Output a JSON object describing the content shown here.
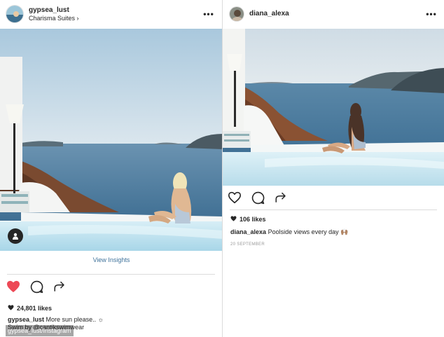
{
  "left_post": {
    "username": "gypsea_lust",
    "location": "Charisma Suites",
    "location_chevron": "›",
    "more_label": "•••",
    "insights_link": "View Insights",
    "liked": true,
    "likes_text": "24,801 likes",
    "caption_user": "gypsea_lust",
    "caption_text": "More sun please.. ☼",
    "caption_line2": "Swim by @cantikswimwear",
    "icons": [
      "heart-icon",
      "comment-icon",
      "share-icon",
      "user-tag-icon"
    ]
  },
  "right_post": {
    "username": "diana_alexa",
    "more_label": "•••",
    "liked": false,
    "likes_text": "106 likes",
    "caption_user": "diana_alexa",
    "caption_text": "Poolside views every day 🙌🏽",
    "date": "20 SEPTEMBER",
    "icons": [
      "heart-icon",
      "comment-icon",
      "share-icon"
    ]
  },
  "watermark": "gypsea_lust/Instagram",
  "colors": {
    "like_red": "#ed4956",
    "link_blue": "#3f729b",
    "text": "#262626",
    "muted": "#999999",
    "border": "#dbdbdb",
    "sky": "#c9dcea",
    "sea": "#4f7fa3",
    "pool": "#bfe2ef"
  }
}
